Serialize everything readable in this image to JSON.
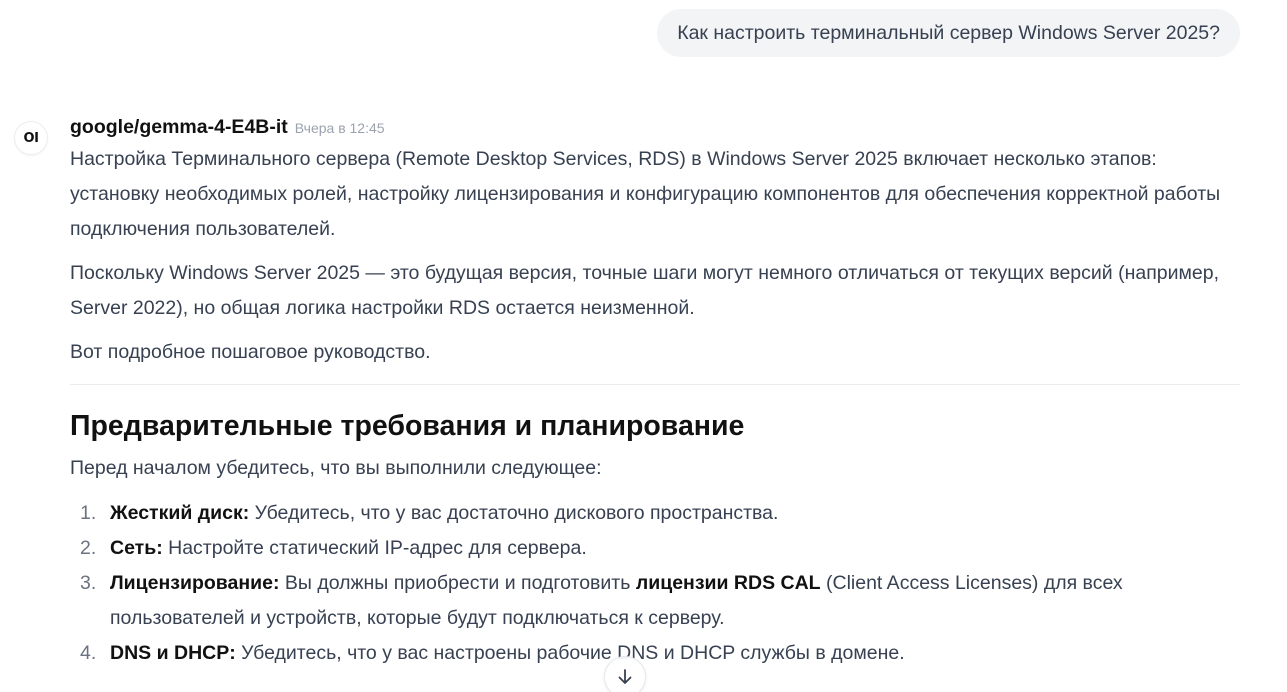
{
  "user_message": "Как настроить терминальный сервер Windows Server 2025?",
  "assistant": {
    "avatar_text": "OI",
    "model_name": "google/gemma-4-E4B-it",
    "timestamp": "Вчера в 12:45",
    "paragraphs": [
      "Настройка Терминального сервера (Remote Desktop Services, RDS) в Windows Server 2025 включает несколько этапов: установку необходимых ролей, настройку лицензирования и конфигурацию компонентов для обеспечения корректной работы подключения пользователей.",
      "Поскольку Windows Server 2025 — это будущая версия, точные шаги могут немного отличаться от текущих версий (например, Server 2022), но общая логика настройки RDS остается неизменной.",
      "Вот подробное пошаговое руководство."
    ],
    "section": {
      "heading": "Предварительные требования и планирование",
      "intro": "Перед началом убедитесь, что вы выполнили следующее:",
      "items": [
        {
          "num": "1.",
          "bold": "Жесткий диск:",
          "text": " Убедитесь, что у вас достаточно дискового пространства."
        },
        {
          "num": "2.",
          "bold": "Сеть:",
          "text": " Настройте статический IP-адрес для сервера."
        },
        {
          "num": "3.",
          "bold": "Лицензирование:",
          "text": " Вы должны приобрести и подготовить ",
          "bold2": "лицензии RDS CAL",
          "text2": " (Client Access Licenses) для всех пользователей и устройств, которые будут подключаться к серверу."
        },
        {
          "num": "4.",
          "bold": "DNS и DHCP:",
          "text": " Убедитесь, что у вас настроены рабочие DNS и DHCP службы в домене."
        }
      ]
    }
  },
  "scroll_button": {
    "icon": "arrow-down-icon"
  }
}
